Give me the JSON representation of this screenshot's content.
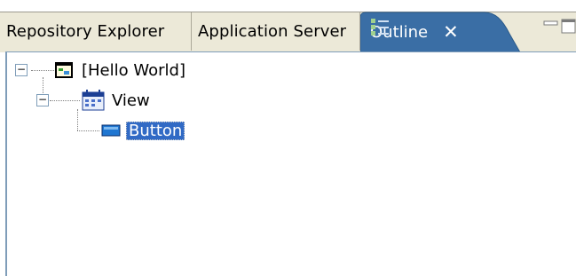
{
  "tabs": [
    {
      "label": "Repository Explorer"
    },
    {
      "label": "Application Server"
    },
    {
      "label": "Outline",
      "active": true,
      "icon": "outline-icon"
    }
  ],
  "colors": {
    "active_tab": "#3a6ea5",
    "selection": "#316ac5",
    "tab_strip": "#ece9d8"
  },
  "tree": {
    "root": {
      "label": "[Hello World]",
      "icon": "form-icon",
      "expanded": true
    },
    "view": {
      "label": "View",
      "icon": "calendar-view-icon",
      "expanded": true
    },
    "button": {
      "label": "Button",
      "icon": "button-widget-icon",
      "selected": true
    }
  }
}
